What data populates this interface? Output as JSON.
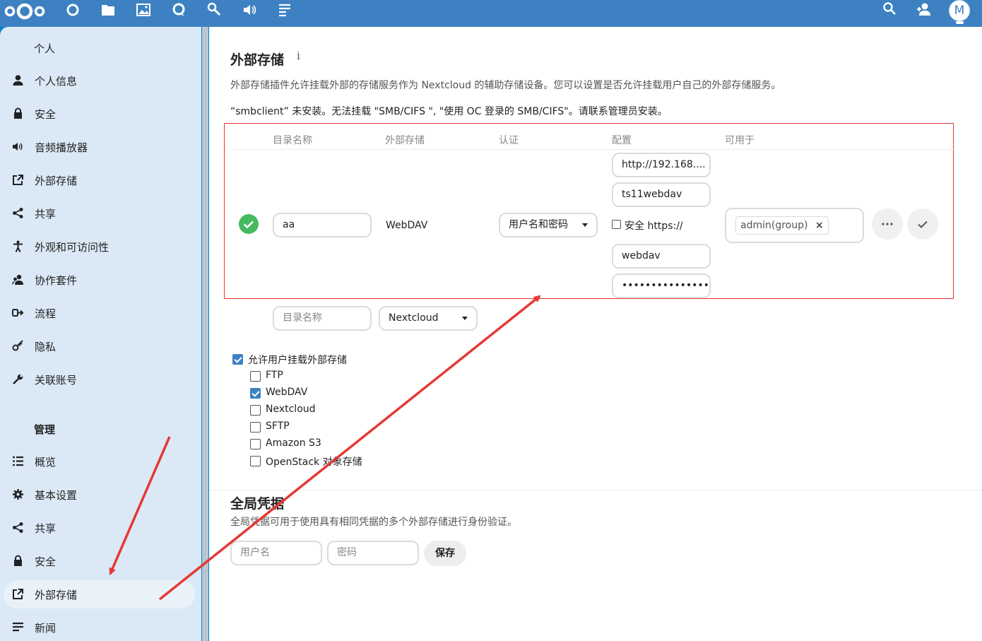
{
  "header": {
    "apps": [
      "dashboard-icon",
      "files-icon",
      "photos-icon",
      "talk-icon",
      "search-apps-icon",
      "audio-icon",
      "activity-icon"
    ],
    "avatar_letter": "M"
  },
  "sidebar": {
    "personal_heading": "个人",
    "personal_items": [
      "个人信息",
      "安全",
      "音频播放器",
      "外部存储",
      "共享",
      "外观和可访问性",
      "协作套件",
      "流程",
      "隐私",
      "关联账号"
    ],
    "admin_heading": "管理",
    "admin_items": [
      "概览",
      "基本设置",
      "共享",
      "安全",
      "外部存储",
      "新闻"
    ]
  },
  "main": {
    "title": "外部存储",
    "info_icon": "i",
    "description": "外部存储插件允许挂载外部的存储服务作为 Nextcloud 的辅助存储设备。您可以设置是否允许挂载用户自己的外部存储服务。",
    "warning": "“smbclient” 未安装。无法挂载 \"SMB/CIFS \", \"使用 OC 登录的 SMB/CIFS\"。请联系管理员安装。",
    "table": {
      "headers": [
        "目录名称",
        "外部存储",
        "认证",
        "配置",
        "可用于"
      ],
      "row": {
        "folder_name": "aa",
        "backend": "WebDAV",
        "auth": "用户名和密码",
        "config_url": "http://192.168....",
        "config_path": "ts11webdav",
        "secure_label": "安全 https://",
        "config_user": "webdav",
        "config_password": "•••••••••••••••",
        "available_for": "admin(group)",
        "tag_remove": "×"
      },
      "new_row": {
        "folder_placeholder": "目录名称",
        "backend": "Nextcloud"
      }
    },
    "allow_user_mount_label": "允许用户挂载外部存储",
    "backends": [
      {
        "label": "FTP",
        "checked": false
      },
      {
        "label": "WebDAV",
        "checked": true
      },
      {
        "label": "Nextcloud",
        "checked": false
      },
      {
        "label": "SFTP",
        "checked": false
      },
      {
        "label": "Amazon S3",
        "checked": false
      },
      {
        "label": "OpenStack 对象存储",
        "checked": false
      }
    ],
    "global": {
      "title": "全局凭据",
      "description": "全局凭据可用于使用具有相同凭据的多个外部存储进行身份验证。",
      "username_placeholder": "用户名",
      "password_placeholder": "密码",
      "save_label": "保存"
    }
  },
  "colors": {
    "header_bg": "#3d81c2",
    "sidebar_bg": "#dbe9f6",
    "success": "#46ba61",
    "annotation": "#e53935",
    "checkbox_on": "#3d81c2"
  }
}
